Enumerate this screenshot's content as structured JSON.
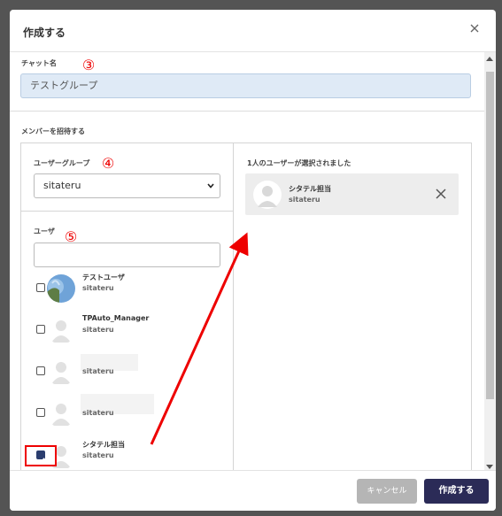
{
  "modal": {
    "title": "作成する"
  },
  "chat_name": {
    "label": "チャット名",
    "value": "テストグループ",
    "annotation": "③"
  },
  "invite": {
    "label": "メンバーを招待する"
  },
  "user_group": {
    "label": "ユーザーグループ",
    "annotation": "④",
    "selected": "sitateru"
  },
  "users": {
    "label": "ユーザ",
    "annotation": "⑤",
    "search_value": "",
    "list": [
      {
        "name": "テストユーザ",
        "org": "sitateru",
        "checked": false,
        "avatar": "photo-avatar"
      },
      {
        "name": "TPAuto_Manager",
        "org": "sitateru",
        "checked": false,
        "avatar": "default-avatar"
      },
      {
        "name": "",
        "org": "sitateru",
        "checked": false,
        "avatar": "default-avatar"
      },
      {
        "name": "",
        "org": "sitateru",
        "checked": false,
        "avatar": "default-avatar"
      },
      {
        "name": "シタテル担当",
        "org": "sitateru",
        "checked": true,
        "avatar": "default-avatar"
      }
    ]
  },
  "selected": {
    "title": "1人のユーザーが選択されました",
    "user_name": "シタテル担当",
    "user_org": "sitateru"
  },
  "footer": {
    "cancel_label": "キャンセル",
    "create_label": "作成する"
  },
  "colors": {
    "accent": "#2b2b57",
    "annotation": "#ee0000",
    "input_bg": "#dfeaf6"
  }
}
